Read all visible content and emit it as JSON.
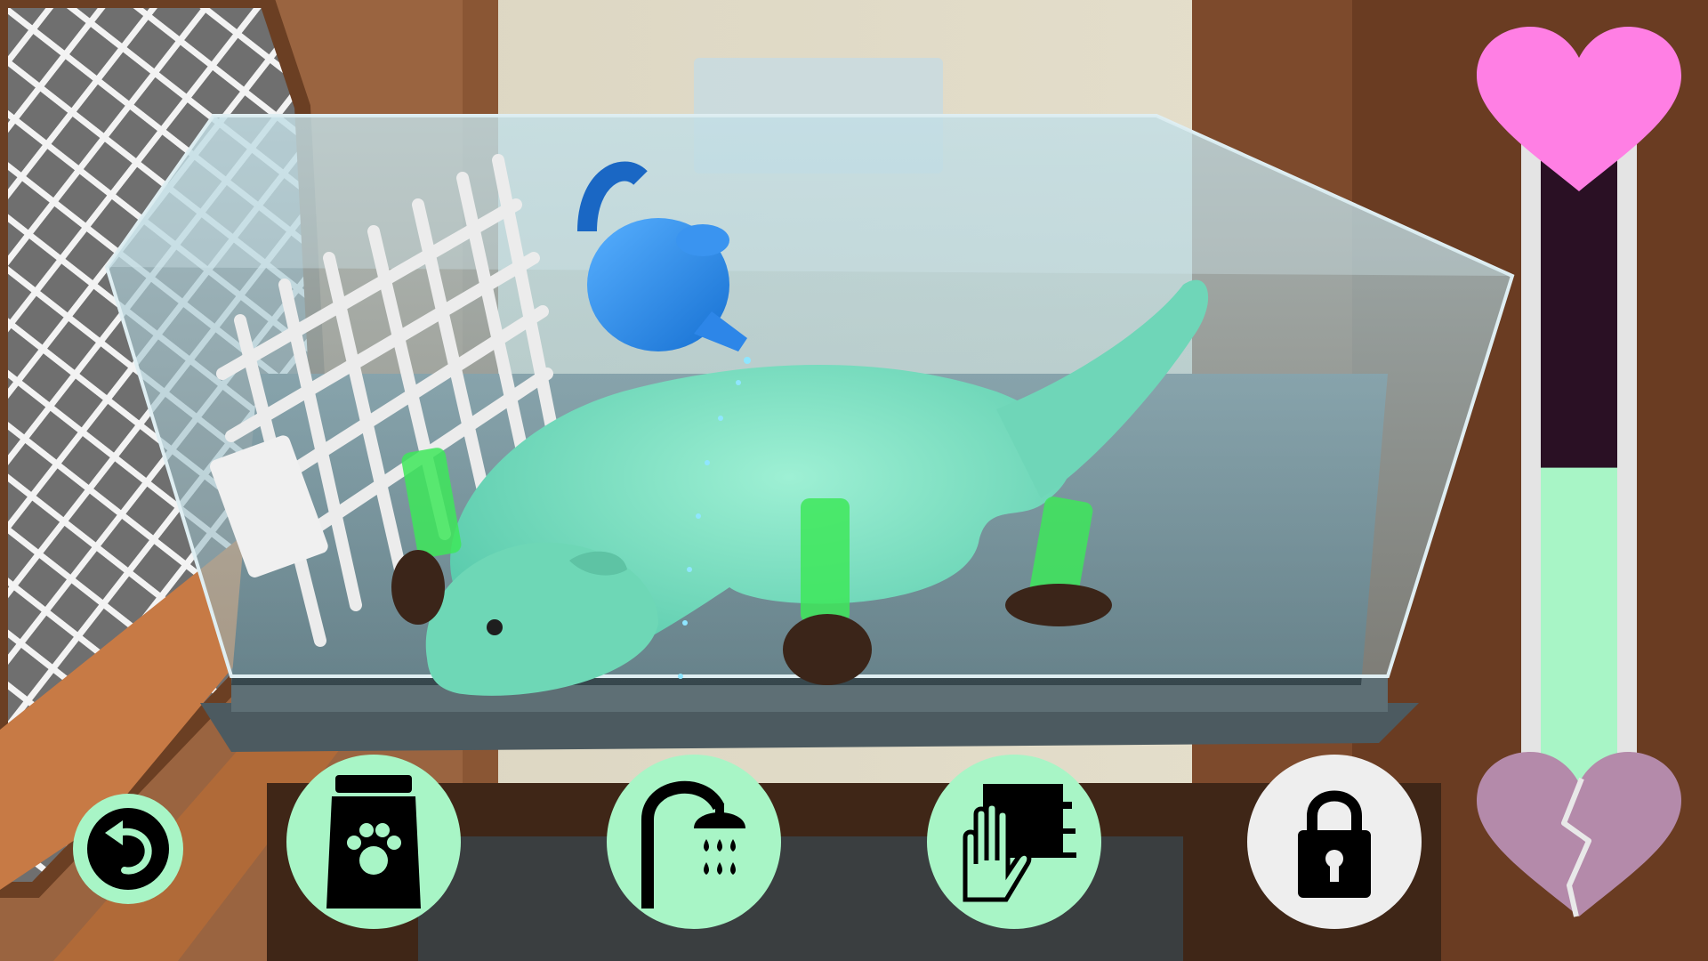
{
  "game": {
    "actions": [
      {
        "id": "back",
        "icon": "undo-arrow-icon"
      },
      {
        "id": "feed",
        "icon": "food-bag-paw-icon"
      },
      {
        "id": "shower",
        "icon": "shower-icon"
      },
      {
        "id": "pet",
        "icon": "hand-petting-icon"
      },
      {
        "id": "locked",
        "icon": "padlock-icon"
      }
    ],
    "happiness_meter": {
      "level": 0.52,
      "top_icon": "pink-heart-icon",
      "bottom_icon": "broken-heart-icon"
    }
  },
  "colors": {
    "button_bg": "#a8f5c6",
    "locked_bg": "#eeeeee",
    "meter_fill": "#a8f5c6",
    "meter_empty": "#2a1024",
    "meter_frame": "#e4e4e4",
    "heart": "#ff7fe4",
    "broken_heart": "#b48aaa"
  }
}
